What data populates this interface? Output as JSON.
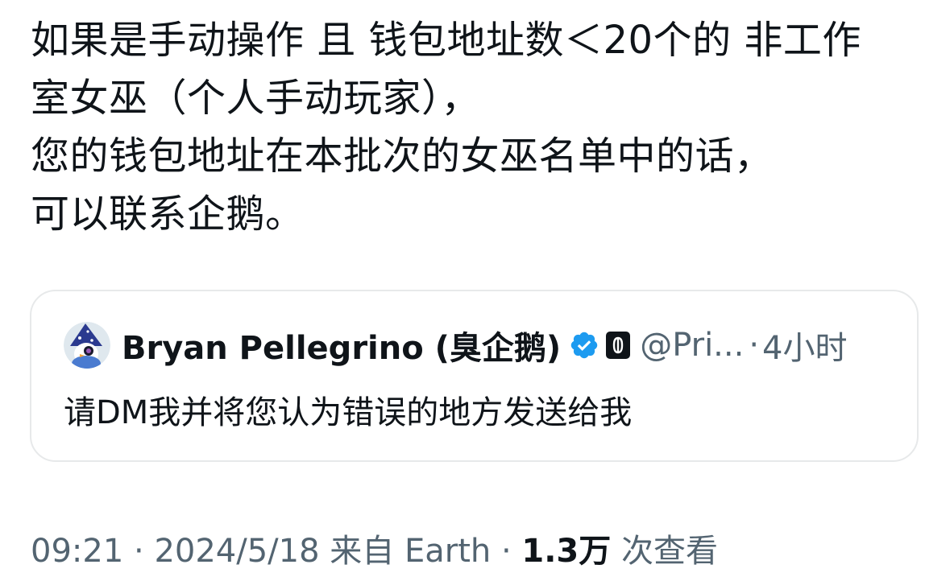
{
  "tweet": {
    "lines": [
      "如果是手动操作 且 钱包地址数＜20个的 非工作",
      "室女巫（个人手动玩家），",
      "您的钱包地址在本批次的女巫名单中的话，",
      "可以联系企鹅。"
    ]
  },
  "quote": {
    "author_name": "Bryan Pellegrino (臭企鹅)",
    "handle": "@Pri...",
    "separator": "·",
    "time": "4小时",
    "text": "请DM我并将您认为错误的地方发送给我",
    "icons": {
      "avatar": "wizard-penguin-avatar",
      "verified": "verified-badge-icon",
      "affiliate": "layerzero-affiliate-icon"
    }
  },
  "meta": {
    "time": "09:21",
    "sep1": " · ",
    "date": "2024/5/18",
    "source_prefix": " 来自 ",
    "source": "Earth",
    "sep2": " · ",
    "views_count": "1.3万",
    "views_label": " 次查看"
  },
  "colors": {
    "text": "#0f1419",
    "secondary": "#536471",
    "border": "#e7e9ea",
    "verified": "#1d9bf0"
  }
}
